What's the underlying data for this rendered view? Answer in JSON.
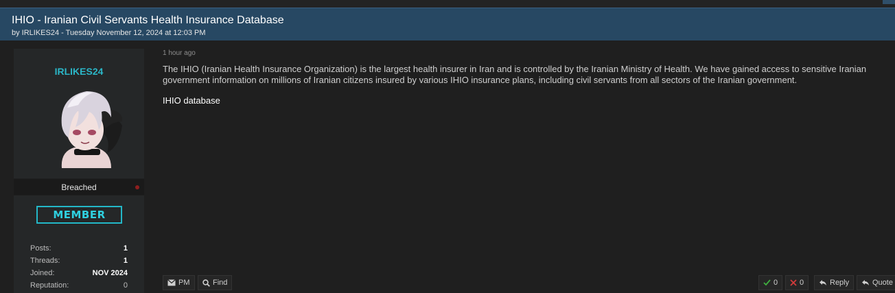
{
  "thread": {
    "title": "IHIO - Iranian Civil Servants Health Insurance Database",
    "meta": "by IRLIKES24 - Tuesday November 12, 2024 at 12:03 PM"
  },
  "author": {
    "username": "IRLIKES24",
    "status": "Breached",
    "rank_badge": "MEMBER",
    "stats": [
      {
        "label": "Posts:",
        "value": "1"
      },
      {
        "label": "Threads:",
        "value": "1"
      },
      {
        "label": "Joined:",
        "value": "NOV 2024"
      },
      {
        "label": "Reputation:",
        "value": "0"
      }
    ]
  },
  "post": {
    "time": "1 hour ago",
    "text": "The IHIO (Iranian Health Insurance Organization) is the largest health insurer in Iran and is controlled by the Iranian Ministry of Health. We have gained access to sensitive Iranian government information on millions of Iranian citizens insured by various IHIO insurance plans, including civil servants from all sectors of the Iranian government.",
    "link_text": "IHIO database"
  },
  "actions": {
    "pm": "PM",
    "find": "Find",
    "upvotes": "0",
    "downvotes": "0",
    "reply": "Reply",
    "quote": "Quote"
  },
  "colors": {
    "header_bg": "#274863",
    "username": "#2bb6c7",
    "badge": "#23b8c8",
    "upvote": "#3fae3f",
    "downvote": "#d23b3b"
  }
}
